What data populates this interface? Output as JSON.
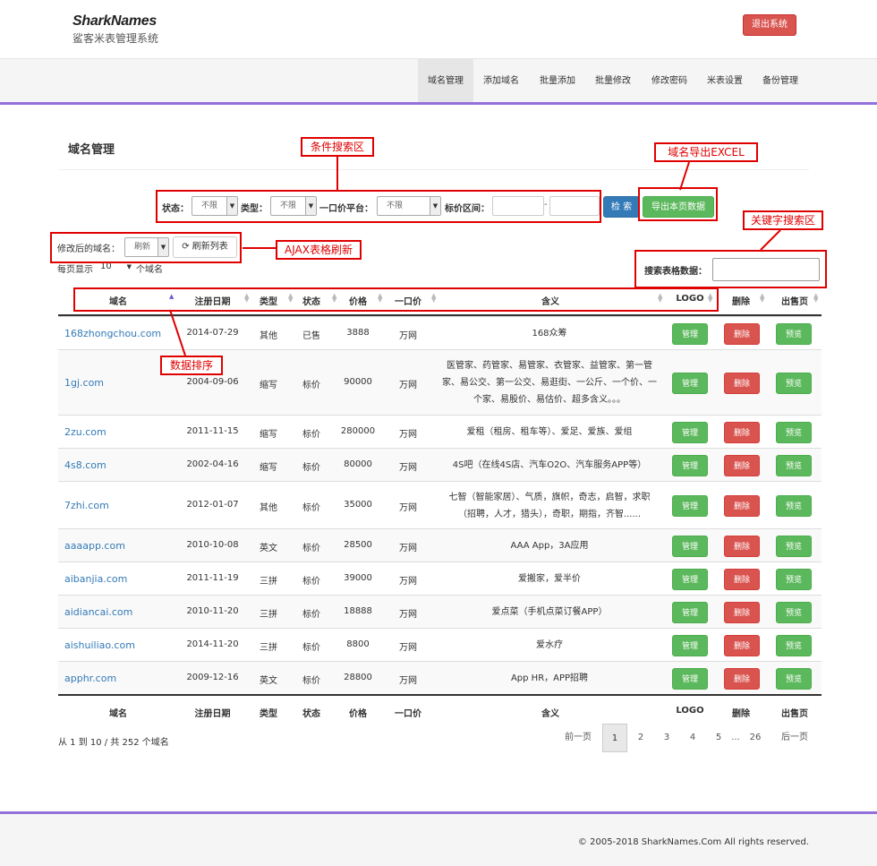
{
  "header": {
    "logo": "SharkNames",
    "subtitle": "鲨客米表管理系统",
    "logout_label": "退出系统"
  },
  "nav": [
    {
      "label": "域名管理",
      "active": true
    },
    {
      "label": "添加域名"
    },
    {
      "label": "批量添加"
    },
    {
      "label": "批量修改"
    },
    {
      "label": "修改密码"
    },
    {
      "label": "米表设置"
    },
    {
      "label": "备份管理"
    }
  ],
  "page_title": "域名管理",
  "filters": {
    "status_label": "状态：",
    "status_value": "不限",
    "type_label": "类型：",
    "type_value": "不限",
    "platform_label": "一口价平台：",
    "platform_value": "不限",
    "price_label": "标价区间：",
    "price_sep": "-",
    "search_button": "检 索",
    "export_button": "导出本页数据"
  },
  "refresh": {
    "label": "修改后的域名：",
    "select_value": "刷新",
    "button": "刷新列表"
  },
  "per_page": {
    "prefix": "每页显示",
    "value": "10",
    "suffix": "个域名"
  },
  "table_search": {
    "label": "搜索表格数据："
  },
  "annotations": {
    "filter_area": "条件搜索区",
    "export": "域名导出EXCEL",
    "keyword_search": "关键字搜索区",
    "ajax_refresh": "AJAX表格刷新",
    "sorting": "数据排序"
  },
  "columns": [
    "域名",
    "注册日期",
    "类型",
    "状态",
    "价格",
    "一口价",
    "含义",
    "LOGO",
    "删除",
    "出售页"
  ],
  "rows": [
    {
      "domain": "168zhongchou.com",
      "date": "2014-07-29",
      "type": "其他",
      "status": "已售",
      "price": "3888",
      "platform": "万网",
      "meaning": "168众筹"
    },
    {
      "domain": "1gj.com",
      "date": "2004-09-06",
      "type": "缩写",
      "status": "标价",
      "price": "90000",
      "platform": "万网",
      "meaning": "医管家、药管家、易管家、衣管家、益管家、第一管家、易公交、第一公交、易逛街、一公斤、一个价、一个家、易股价、易估价、超多含义。。。"
    },
    {
      "domain": "2zu.com",
      "date": "2011-11-15",
      "type": "缩写",
      "status": "标价",
      "price": "280000",
      "platform": "万网",
      "meaning": "爱租（租房、租车等）、爱足、爱族、爱组"
    },
    {
      "domain": "4s8.com",
      "date": "2002-04-16",
      "type": "缩写",
      "status": "标价",
      "price": "80000",
      "platform": "万网",
      "meaning": "4S吧（在线4S店、汽车O2O、汽车服务APP等）"
    },
    {
      "domain": "7zhi.com",
      "date": "2012-01-07",
      "type": "其他",
      "status": "标价",
      "price": "35000",
      "platform": "万网",
      "meaning": "七智（智能家居）、气质，旗帜，奇志，启智，求职（招聘，人才，猎头），奇职，期指，齐智......"
    },
    {
      "domain": "aaaapp.com",
      "date": "2010-10-08",
      "type": "英文",
      "status": "标价",
      "price": "28500",
      "platform": "万网",
      "meaning": "AAA App，3A应用"
    },
    {
      "domain": "aibanjia.com",
      "date": "2011-11-19",
      "type": "三拼",
      "status": "标价",
      "price": "39000",
      "platform": "万网",
      "meaning": "爱搬家，爱半价"
    },
    {
      "domain": "aidiancai.com",
      "date": "2010-11-20",
      "type": "三拼",
      "status": "标价",
      "price": "18888",
      "platform": "万网",
      "meaning": "爱点菜（手机点菜订餐APP）"
    },
    {
      "domain": "aishuiliao.com",
      "date": "2014-11-20",
      "type": "三拼",
      "status": "标价",
      "price": "8800",
      "platform": "万网",
      "meaning": "爱水疗"
    },
    {
      "domain": "apphr.com",
      "date": "2009-12-16",
      "type": "英文",
      "status": "标价",
      "price": "28800",
      "platform": "万网",
      "meaning": "App HR，APP招聘"
    }
  ],
  "row_buttons": {
    "manage": "管理",
    "delete": "删除",
    "preview": "预览"
  },
  "summary": "从 1 到 10 / 共 252 个域名",
  "pagination": {
    "prev": "前一页",
    "pages": [
      "1",
      "2",
      "3",
      "4",
      "5"
    ],
    "ellipsis": "...",
    "last": "26",
    "next": "后一页"
  },
  "footer": "© 2005-2018 SharkNames.Com All rights reserved.",
  "colors": {
    "accent": "#9370db",
    "success": "#5cb85c",
    "danger": "#d9534f",
    "primary": "#337ab7",
    "annotation": "#e00000"
  }
}
